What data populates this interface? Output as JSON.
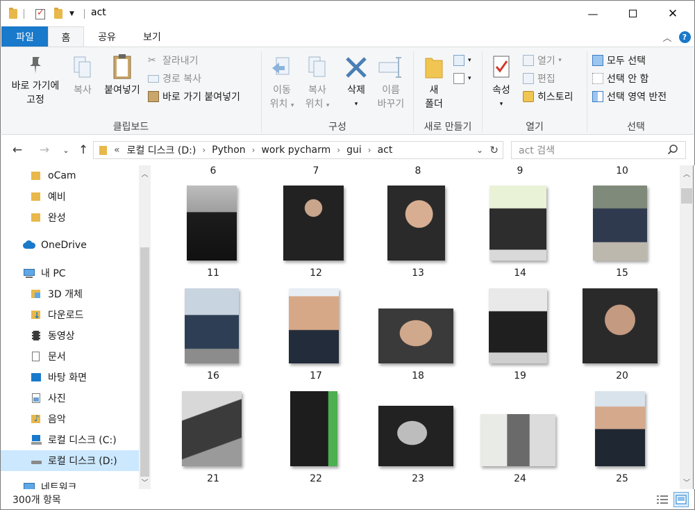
{
  "window": {
    "title": "act"
  },
  "ribbon_tabs": [
    "파일",
    "홈",
    "공유",
    "보기"
  ],
  "ribbon": {
    "clipboard": {
      "pin": "바로 가기에\n고정",
      "pin_l1": "바로 가기에",
      "pin_l2": "고정",
      "copy": "복사",
      "paste": "붙여넣기",
      "cut": "잘라내기",
      "copy_path": "경로 복사",
      "paste_shortcut": "바로 가기 붙여넣기",
      "label": "클립보드"
    },
    "organize": {
      "move_l1": "이동",
      "move_l2": "위치",
      "copy_l1": "복사",
      "copy_l2": "위치",
      "delete": "삭제",
      "rename_l1": "이름",
      "rename_l2": "바꾸기",
      "label": "구성"
    },
    "new": {
      "folder_l1": "새",
      "folder_l2": "폴더",
      "label": "새로 만들기"
    },
    "open": {
      "properties": "속성",
      "open": "열기",
      "edit": "편집",
      "history": "히스토리",
      "label": "열기"
    },
    "select": {
      "select_all": "모두 선택",
      "select_none": "선택 안 함",
      "invert": "선택 영역 반전",
      "label": "선택"
    }
  },
  "address": {
    "prefix": "«",
    "crumbs": [
      "로컬 디스크 (D:)",
      "Python",
      "work pycharm",
      "gui",
      "act"
    ],
    "search_placeholder": "act 검색"
  },
  "sidebar": {
    "items": [
      "oCam",
      "예비",
      "완성",
      "OneDrive",
      "내 PC",
      "3D 개체",
      "다운로드",
      "동영상",
      "문서",
      "바탕 화면",
      "사진",
      "음악",
      "로컬 디스크 (C:)",
      "로컬 디스크 (D:)",
      "네트워크"
    ]
  },
  "files": {
    "top_row": [
      "6",
      "7",
      "8",
      "9",
      "10"
    ],
    "rows": [
      [
        "11",
        "12",
        "13",
        "14",
        "15"
      ],
      [
        "16",
        "17",
        "18",
        "19",
        "20"
      ],
      [
        "21",
        "22",
        "23",
        "24",
        "25"
      ]
    ]
  },
  "status": {
    "count": "300개 항목"
  },
  "colors": {
    "accent": "#1979ca",
    "selected": "#cce8ff",
    "folder": "#e8b84a"
  }
}
